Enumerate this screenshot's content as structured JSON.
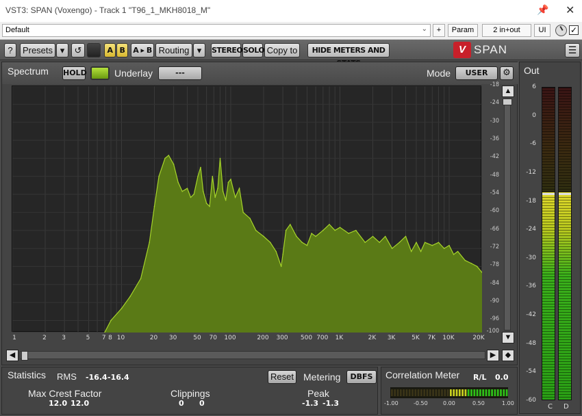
{
  "window": {
    "title": "VST3: SPAN (Voxengo) - Track 1 \"T96_1_MKH8018_M\"",
    "pin_icon": "pin-icon",
    "close_symbol": "✕"
  },
  "host": {
    "preset": "Default",
    "plus_label": "+",
    "param_label": "Param",
    "io_label": "2 in+out",
    "ui_label": "UI",
    "bypass_checked": "✓"
  },
  "toolbar": {
    "help": "?",
    "presets": "Presets",
    "dropdown": "▾",
    "undo": "↺",
    "a": "A",
    "b": "B",
    "ab": "A ▸ B",
    "routing": "Routing",
    "stereo": "STEREO",
    "solo": "SOLO",
    "copy_to": "Copy to",
    "hide_meters": "HIDE METERS AND STATS",
    "logo_letter": "V",
    "logo_text": "SPAN",
    "menu": "☰"
  },
  "spectrum": {
    "title": "Spectrum",
    "hold": "HOLD",
    "underlay_label": "Underlay",
    "underlay_value": "---",
    "mode_label": "Mode",
    "mode_value": "USER",
    "gear_icon": "gear-icon",
    "fill_color": "#5a7a16",
    "line_color": "#a6d42a"
  },
  "chart_data": {
    "type": "area",
    "xscale": "log",
    "xlim": [
      1,
      20000
    ],
    "ylim": [
      -100,
      -18
    ],
    "x_ticks": [
      "1",
      "2",
      "3",
      "5",
      "7",
      "8",
      "10",
      "20",
      "30",
      "50",
      "70",
      "100",
      "200",
      "300",
      "500",
      "700",
      "1K",
      "2K",
      "3K",
      "5K",
      "7K",
      "10K",
      "20K"
    ],
    "y_ticks": [
      "-18",
      "-24",
      "-30",
      "-36",
      "-42",
      "-48",
      "-54",
      "-60",
      "-66",
      "-72",
      "-78",
      "-84",
      "-90",
      "-96",
      "-100"
    ],
    "x": [
      7,
      8,
      10,
      12,
      15,
      18,
      20,
      22,
      25,
      27,
      30,
      33,
      36,
      40,
      43,
      46,
      50,
      53,
      56,
      60,
      64,
      68,
      72,
      76,
      80,
      85,
      90,
      95,
      100,
      110,
      120,
      130,
      150,
      170,
      200,
      230,
      260,
      290,
      300,
      320,
      350,
      400,
      450,
      500,
      550,
      600,
      700,
      800,
      900,
      1000,
      1200,
      1400,
      1700,
      2000,
      2300,
      2600,
      3000,
      3500,
      4000,
      4500,
      5000,
      5500,
      6000,
      7000,
      8000,
      9000,
      10000,
      11000,
      12000,
      14000,
      16000,
      18000,
      20000
    ],
    "values": [
      -100,
      -96,
      -92,
      -88,
      -82,
      -70,
      -58,
      -48,
      -42,
      -41,
      -44,
      -50,
      -53,
      -52,
      -55,
      -54,
      -48,
      -45,
      -53,
      -57,
      -58,
      -48,
      -55,
      -52,
      -42,
      -53,
      -56,
      -50,
      -49,
      -55,
      -52,
      -60,
      -62,
      -66,
      -68,
      -70,
      -73,
      -78,
      -74,
      -66,
      -64,
      -68,
      -70,
      -71,
      -67,
      -68,
      -66,
      -64,
      -66,
      -65,
      -67,
      -66,
      -70,
      -68,
      -70,
      -68,
      -72,
      -70,
      -68,
      -73,
      -70,
      -73,
      -70,
      -71,
      -70,
      -72,
      -71,
      -74,
      -73,
      -76,
      -77,
      -78,
      -80
    ]
  },
  "out": {
    "title": "Out",
    "ticks": [
      "6",
      "0",
      "-6",
      "-12",
      "-18",
      "-24",
      "-30",
      "-36",
      "-42",
      "-48",
      "-54",
      "-60"
    ],
    "ch_left": "C",
    "ch_right": "D",
    "level_db": -16.4,
    "peak_db": -16.4,
    "range_db": [
      -60,
      6
    ]
  },
  "stats": {
    "title": "Statistics",
    "rms_label": "RMS",
    "rms_l": "-16.4",
    "rms_r": "-16.4",
    "reset": "Reset",
    "metering_label": "Metering",
    "metering_value": "DBFS",
    "crest_label": "Max Crest Factor",
    "crest_l": "12.0",
    "crest_r": "12.0",
    "clip_label": "Clippings",
    "clip_l": "0",
    "clip_r": "0",
    "peak_label": "Peak",
    "peak_l": "-1.3",
    "peak_r": "-1.3"
  },
  "correlation": {
    "title": "Correlation Meter",
    "rl_label": "R/L",
    "rl_value": "0.0",
    "scale": [
      "-1.00",
      "-0.50",
      "0.00",
      "0.50",
      "1.00"
    ],
    "value": 0.0
  }
}
